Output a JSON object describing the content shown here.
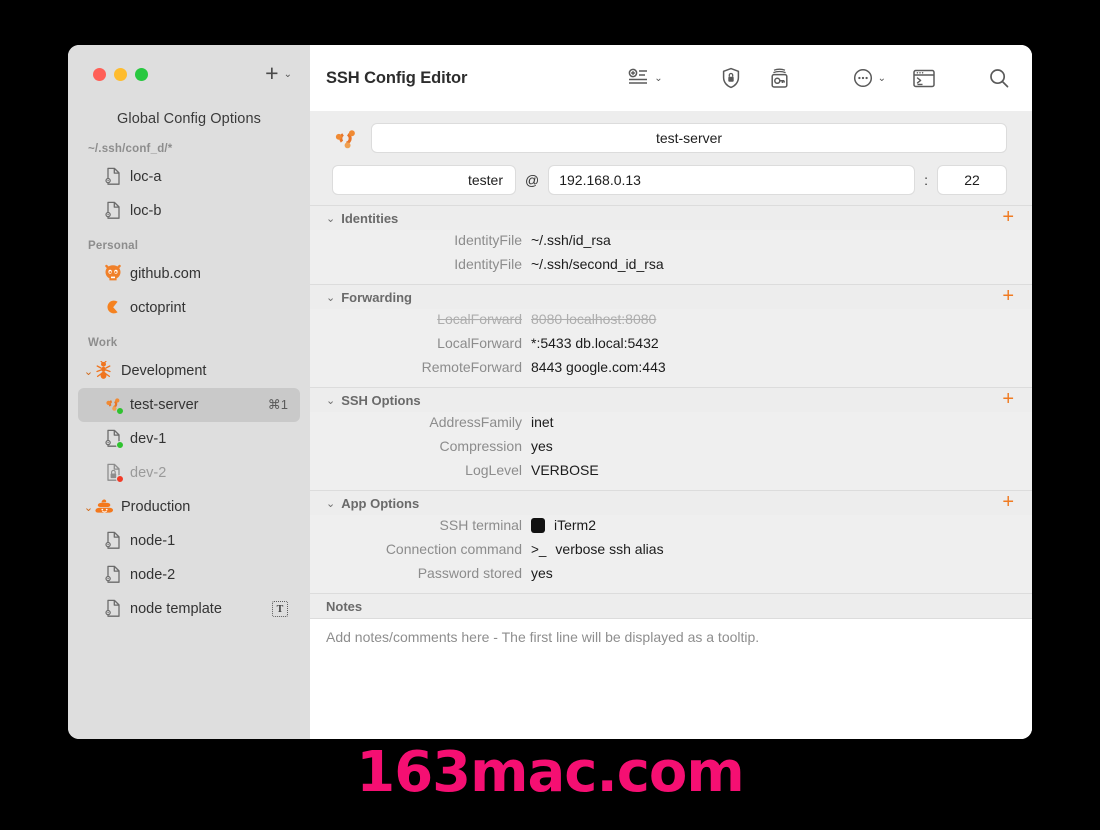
{
  "window": {
    "traffic_lights": [
      "close",
      "minimize",
      "zoom"
    ],
    "add_button": "+",
    "add_chevron": "⌄"
  },
  "sidebar": {
    "title": "Global Config Options",
    "groups": [
      {
        "header": "~/.ssh/conf_d/*",
        "items": [
          {
            "label": "loc-a",
            "icon": "doc-gear-icon",
            "indent": "child",
            "status": null,
            "dim": false,
            "shortcut": null,
            "badge": null
          },
          {
            "label": "loc-b",
            "icon": "doc-gear-icon",
            "indent": "child",
            "status": null,
            "dim": false,
            "shortcut": null,
            "badge": null
          }
        ]
      },
      {
        "header": "Personal",
        "items": [
          {
            "label": "github.com",
            "icon": "github-octocat-icon",
            "indent": "child",
            "status": null,
            "dim": false,
            "shortcut": null,
            "badge": null
          },
          {
            "label": "octoprint",
            "icon": "octoprint-icon",
            "indent": "child",
            "status": null,
            "dim": false,
            "shortcut": null,
            "badge": null
          }
        ]
      },
      {
        "header": "Work",
        "items": [
          {
            "label": "Development",
            "icon": "ant-icon",
            "indent": "group",
            "status": null,
            "dim": false,
            "shortcut": null,
            "badge": null,
            "disclosure": "⌄"
          },
          {
            "label": "test-server",
            "icon": "ubuntu-icon",
            "indent": "child",
            "status": "green",
            "dim": false,
            "shortcut": "⌘1",
            "badge": null,
            "selected": true
          },
          {
            "label": "dev-1",
            "icon": "doc-gear-icon",
            "indent": "child",
            "status": "green",
            "dim": false,
            "shortcut": null,
            "badge": null
          },
          {
            "label": "dev-2",
            "icon": "doc-lock-icon",
            "indent": "child",
            "status": "red",
            "dim": true,
            "shortcut": null,
            "badge": null
          },
          {
            "label": "Production",
            "icon": "poop-icon",
            "indent": "group",
            "status": null,
            "dim": false,
            "shortcut": null,
            "badge": null,
            "disclosure": "⌄"
          },
          {
            "label": "node-1",
            "icon": "doc-gear-icon",
            "indent": "child",
            "status": null,
            "dim": false,
            "shortcut": null,
            "badge": null
          },
          {
            "label": "node-2",
            "icon": "doc-gear-icon",
            "indent": "child",
            "status": null,
            "dim": false,
            "shortcut": null,
            "badge": null
          },
          {
            "label": "node template",
            "icon": "doc-gear-icon",
            "indent": "child",
            "status": null,
            "dim": false,
            "shortcut": null,
            "badge": "T"
          }
        ]
      }
    ]
  },
  "toolbar": {
    "title": "SSH Config Editor",
    "icons": [
      {
        "name": "add-to-list-icon",
        "chevron": "⌄"
      },
      {
        "name": "shield-lock-icon",
        "chevron": null
      },
      {
        "name": "keychain-icon",
        "chevron": null
      },
      {
        "name": "ellipsis-circle-icon",
        "chevron": "⌄"
      },
      {
        "name": "terminal-icon",
        "chevron": null
      },
      {
        "name": "search-icon",
        "chevron": null
      }
    ]
  },
  "host": {
    "icon": "ubuntu-icon",
    "name": "test-server",
    "user": "tester",
    "at": "@",
    "address": "192.168.0.13",
    "colon": ":",
    "port": "22"
  },
  "sections": [
    {
      "title": "Identities",
      "chevron": "⌄",
      "add": "+",
      "rows": [
        {
          "label": "IdentityFile",
          "value": "~/.ssh/id_rsa",
          "disabled": false,
          "icon": null
        },
        {
          "label": "IdentityFile",
          "value": "~/.ssh/second_id_rsa",
          "disabled": false,
          "icon": null
        }
      ]
    },
    {
      "title": "Forwarding",
      "chevron": "⌄",
      "add": "+",
      "rows": [
        {
          "label": "LocalForward",
          "value": "8080 localhost:8080",
          "disabled": true,
          "icon": null
        },
        {
          "label": "LocalForward",
          "value": "*:5433 db.local:5432",
          "disabled": false,
          "icon": null
        },
        {
          "label": "RemoteForward",
          "value": "8443 google.com:443",
          "disabled": false,
          "icon": null
        }
      ]
    },
    {
      "title": "SSH Options",
      "chevron": "⌄",
      "add": "+",
      "rows": [
        {
          "label": "AddressFamily",
          "value": "inet",
          "disabled": false,
          "icon": null
        },
        {
          "label": "Compression",
          "value": "yes",
          "disabled": false,
          "icon": null
        },
        {
          "label": "LogLevel",
          "value": "VERBOSE",
          "disabled": false,
          "icon": null
        }
      ]
    },
    {
      "title": "App Options",
      "chevron": "⌄",
      "add": "+",
      "rows": [
        {
          "label": "SSH terminal",
          "value": "iTerm2",
          "disabled": false,
          "icon": "iterm-app-icon"
        },
        {
          "label": "Connection command",
          "value": "verbose ssh alias",
          "disabled": false,
          "icon": "prompt-icon",
          "icon_text": ">_"
        },
        {
          "label": "Password stored",
          "value": "yes",
          "disabled": false,
          "icon": null
        }
      ]
    }
  ],
  "notes": {
    "title": "Notes",
    "placeholder": "Add notes/comments here - The first line will be displayed as a tooltip."
  },
  "watermark": {
    "text": "163mac.com",
    "color": "#f50f72"
  },
  "colors": {
    "accent_orange": "#f07b22",
    "sidebar_bg": "#dedede",
    "selection_bg": "#c9c9c9",
    "detail_bg": "#ededed",
    "status_green": "#2fc22f",
    "status_red": "#f13b27"
  }
}
